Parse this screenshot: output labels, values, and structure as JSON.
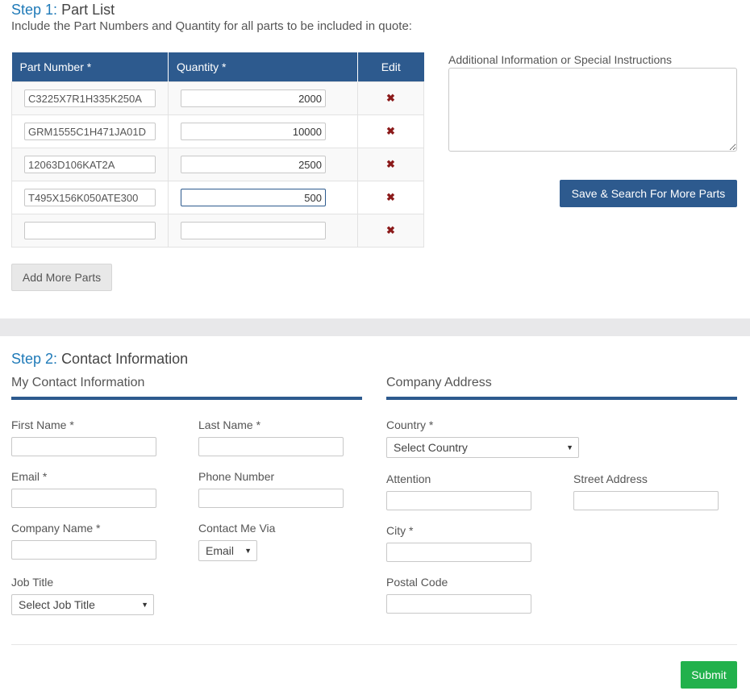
{
  "step1": {
    "step_label": "Step 1:",
    "title": "Part List",
    "subtitle": "Include the Part Numbers and Quantity for all parts to be included in quote:",
    "columns": [
      "Part Number *",
      "Quantity *",
      "Edit"
    ],
    "rows": [
      {
        "part": "C3225X7R1H335K250A",
        "qty": "2000"
      },
      {
        "part": "GRM1555C1H471JA01D",
        "qty": "10000"
      },
      {
        "part": "12063D106KAT2A",
        "qty": "2500"
      },
      {
        "part": "T495X156K050ATE300",
        "qty": "500"
      },
      {
        "part": "",
        "qty": ""
      }
    ],
    "remove_icon": "✖",
    "add_more_label": "Add More Parts",
    "notes_label": "Additional Information or Special Instructions",
    "save_search_label": "Save & Search For More Parts"
  },
  "step2": {
    "step_label": "Step 2:",
    "title": "Contact Information",
    "my_contact_heading": "My Contact Information",
    "company_heading": "Company Address",
    "first_name_label": "First Name *",
    "last_name_label": "Last Name *",
    "email_label": "Email *",
    "phone_label": "Phone Number",
    "company_name_label": "Company Name *",
    "contact_via_label": "Contact Me Via",
    "contact_via_value": "Email",
    "job_title_label": "Job Title",
    "job_title_value": "Select Job Title",
    "country_label": "Country *",
    "country_value": "Select Country",
    "attention_label": "Attention",
    "street_label": "Street Address",
    "city_label": "City *",
    "postal_label": "Postal Code",
    "caret": "▼",
    "submit_label": "Submit"
  },
  "colors": {
    "brand_blue": "#2d5a8e",
    "step_blue": "#1f7ab8",
    "submit_green": "#22b14c",
    "remove_red": "#8b1a1a"
  }
}
